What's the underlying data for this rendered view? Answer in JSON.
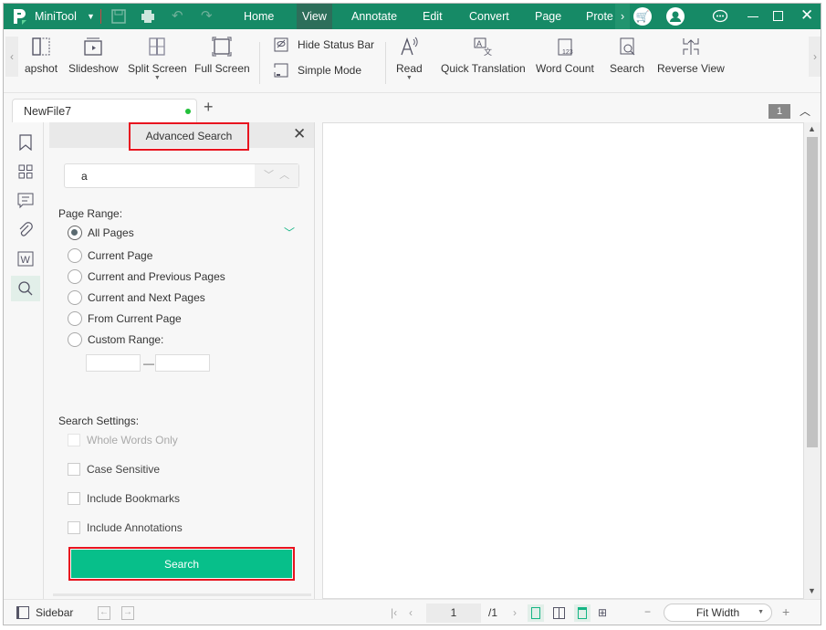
{
  "app": {
    "name": "MiniTool",
    "brand_color": "#168a66",
    "accent": "#07bf8a",
    "highlight": "#e8141f"
  },
  "menu": [
    "Home",
    "View",
    "Annotate",
    "Edit",
    "Convert",
    "Page",
    "Prote"
  ],
  "active_menu": "View",
  "toolbar": {
    "snapshot": "apshot",
    "slideshow": "Slideshow",
    "split_screen": "Split Screen",
    "full_screen": "Full Screen",
    "hide_status_bar": "Hide Status Bar",
    "simple_mode": "Simple Mode",
    "read": "Read",
    "quick_translation": "Quick Translation",
    "word_count": "Word Count",
    "search": "Search",
    "reverse_view": "Reverse View"
  },
  "tabs": {
    "file": "NewFile7",
    "page_badge": "1"
  },
  "panel": {
    "title": "Advanced Search",
    "query": "a",
    "page_range_label": "Page Range:",
    "ranges": [
      "All Pages",
      "Current Page",
      "Current and Previous Pages",
      "Current and Next Pages",
      "From Current Page",
      "Custom Range:"
    ],
    "selected_range": "All Pages",
    "custom_sep": "—",
    "settings_label": "Search Settings:",
    "settings": [
      "Whole Words Only",
      "Case Sensitive",
      "Include Bookmarks",
      "Include Annotations"
    ],
    "search_button": "Search"
  },
  "status": {
    "sidebar": "Sidebar",
    "page": "1",
    "total": "/1",
    "zoom": "Fit Width"
  }
}
